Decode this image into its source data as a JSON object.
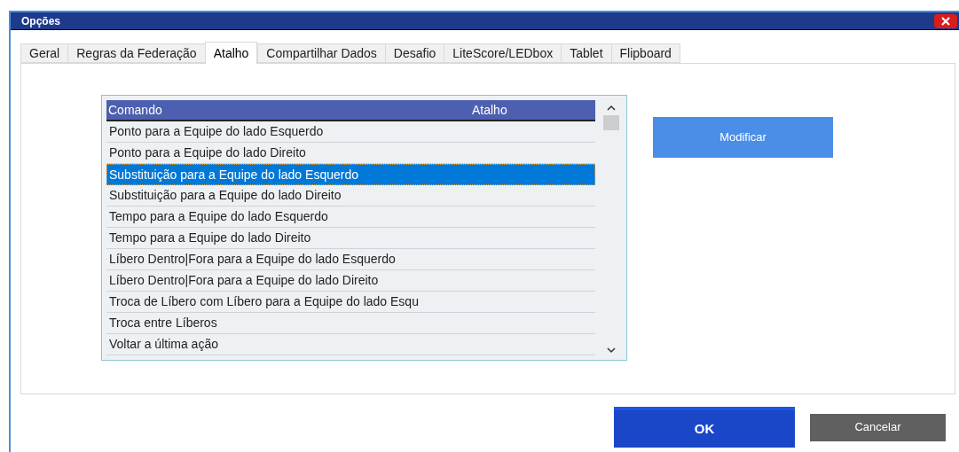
{
  "window": {
    "title": "Opções"
  },
  "tabs": [
    {
      "label": "Geral",
      "selected": false
    },
    {
      "label": "Regras da Federação",
      "selected": false
    },
    {
      "label": "Atalho",
      "selected": true
    },
    {
      "label": "Compartilhar Dados",
      "selected": false
    },
    {
      "label": "Desafio",
      "selected": false
    },
    {
      "label": "LiteScore/LEDbox",
      "selected": false
    },
    {
      "label": "Tablet",
      "selected": false
    },
    {
      "label": "Flipboard",
      "selected": false
    }
  ],
  "table": {
    "columns": [
      "Comando",
      "Atalho"
    ],
    "rows": [
      {
        "command": "Ponto para a Equipe do lado Esquerdo",
        "selected": false
      },
      {
        "command": "Ponto para a Equipe do lado Direito",
        "selected": false
      },
      {
        "command": "Substituição para a Equipe do lado Esquerdo",
        "selected": true
      },
      {
        "command": "Substituição para a Equipe do lado Direito",
        "selected": false
      },
      {
        "command": "Tempo para a Equipe do lado Esquerdo",
        "selected": false
      },
      {
        "command": "Tempo para a Equipe do lado Direito",
        "selected": false
      },
      {
        "command": "Líbero Dentro|Fora para a Equipe do lado Esquerdo",
        "selected": false
      },
      {
        "command": "Líbero Dentro|Fora para a Equipe do lado Direito",
        "selected": false
      },
      {
        "command": "Troca de Líbero com Líbero para a Equipe do lado Esqu",
        "selected": false
      },
      {
        "command": "Troca entre Líberos",
        "selected": false
      },
      {
        "command": "Voltar a última ação",
        "selected": false
      }
    ]
  },
  "modify_button": "Modificar",
  "buttons": {
    "ok": "OK",
    "cancel": "Cancelar"
  }
}
